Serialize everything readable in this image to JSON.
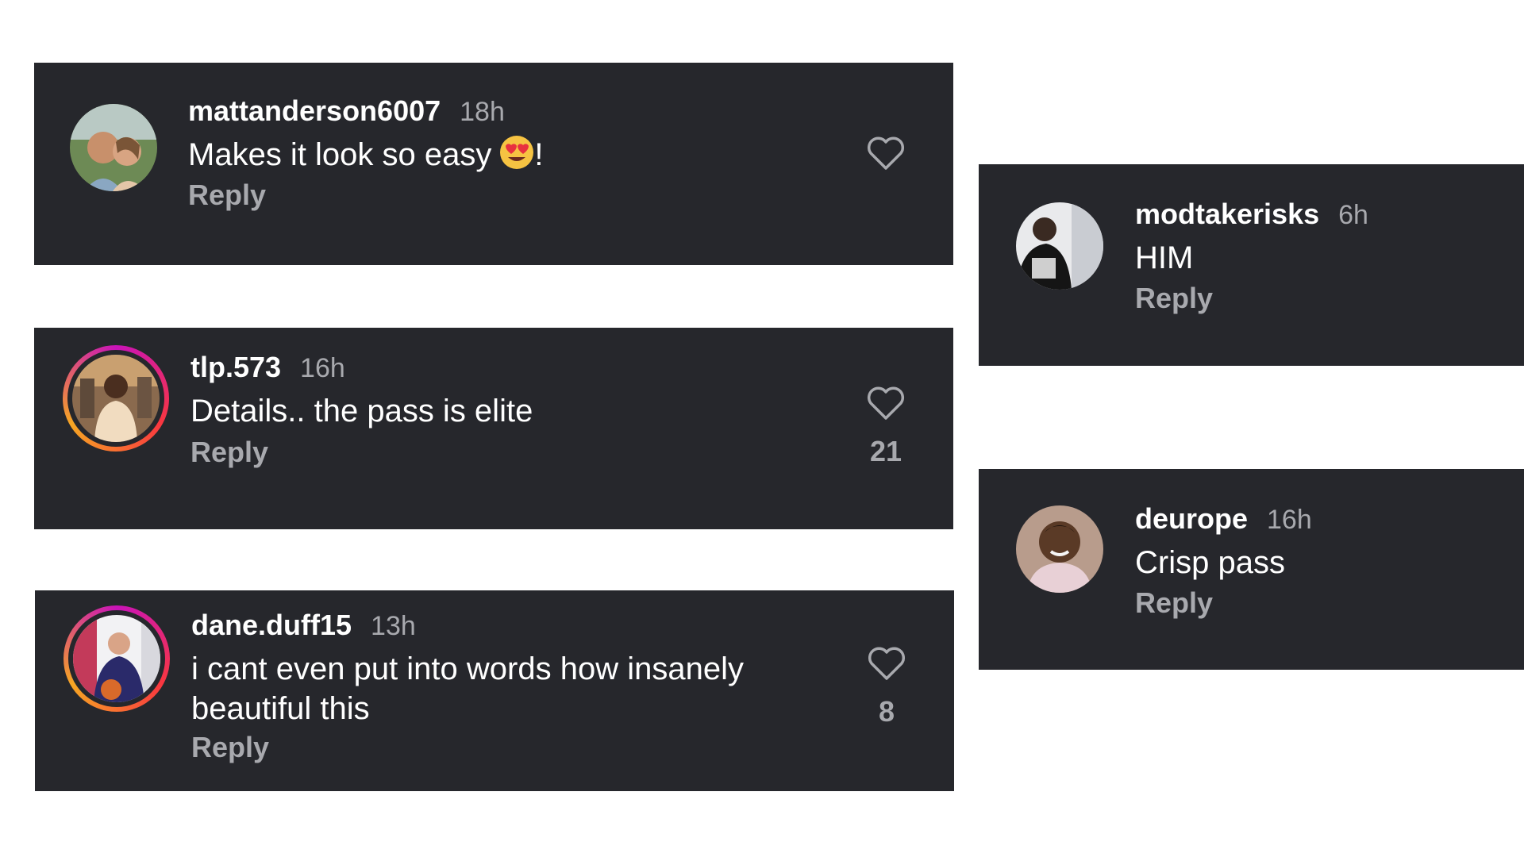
{
  "comments": [
    {
      "username": "mattanderson6007",
      "time": "18h",
      "text": "Makes it look so easy",
      "emoji": "heart-eyes-emoji",
      "text_suffix": "!",
      "reply_label": "Reply",
      "likes": "",
      "avatar_ring": false
    },
    {
      "username": "tlp.573",
      "time": "16h",
      "text": "Details.. the pass is elite",
      "reply_label": "Reply",
      "likes": "21",
      "avatar_ring": true
    },
    {
      "username": "dane.duff15",
      "time": "13h",
      "text": "i cant even put into words how insanely beautiful this",
      "reply_label": "Reply",
      "likes": "8",
      "avatar_ring": true
    },
    {
      "username": "modtakerisks",
      "time": "6h",
      "text": "HIM",
      "reply_label": "Reply",
      "likes": "",
      "avatar_ring": false
    },
    {
      "username": "deurope",
      "time": "16h",
      "text": "Crisp pass",
      "reply_label": "Reply",
      "likes": "",
      "avatar_ring": false
    }
  ],
  "icons": {
    "like": "heart-outline-icon"
  },
  "colors": {
    "card_bg": "#26272c",
    "username": "#ffffff",
    "meta": "#a8a9ae",
    "ring_start": "#c913b9",
    "ring_end": "#f6a623"
  }
}
